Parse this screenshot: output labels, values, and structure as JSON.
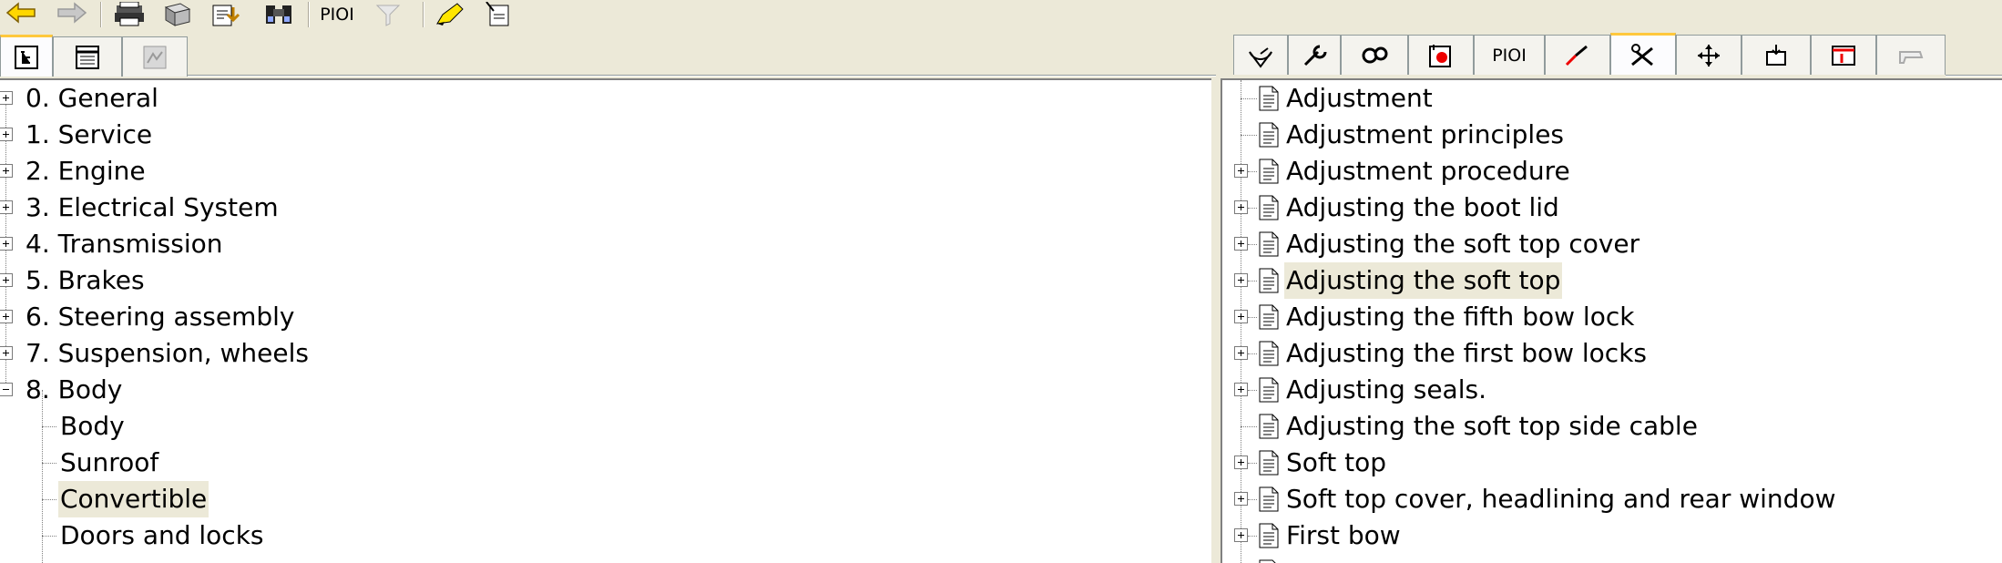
{
  "toolbar": {
    "pioi_label": "PIOI"
  },
  "right_tabs": {
    "pioi_label": "PIOI"
  },
  "left_tree": {
    "items": [
      {
        "label": "0. General",
        "expanded": false
      },
      {
        "label": "1. Service",
        "expanded": false
      },
      {
        "label": "2. Engine",
        "expanded": false
      },
      {
        "label": "3. Electrical System",
        "expanded": false
      },
      {
        "label": "4. Transmission",
        "expanded": false
      },
      {
        "label": "5. Brakes",
        "expanded": false
      },
      {
        "label": "6. Steering assembly",
        "expanded": false
      },
      {
        "label": "7. Suspension, wheels",
        "expanded": false
      },
      {
        "label": "8. Body",
        "expanded": true
      }
    ],
    "children": [
      {
        "label": "Body",
        "selected": false
      },
      {
        "label": "Sunroof",
        "selected": false
      },
      {
        "label": "Convertible",
        "selected": true
      },
      {
        "label": "Doors and locks",
        "selected": false
      }
    ]
  },
  "right_tree": {
    "items": [
      {
        "label": "Adjustment",
        "expandable": false,
        "selected": false
      },
      {
        "label": "Adjustment principles",
        "expandable": false,
        "selected": false
      },
      {
        "label": "Adjustment procedure",
        "expandable": true,
        "selected": false
      },
      {
        "label": "Adjusting the boot lid",
        "expandable": true,
        "selected": false
      },
      {
        "label": "Adjusting the soft top cover",
        "expandable": true,
        "selected": false
      },
      {
        "label": "Adjusting the soft top",
        "expandable": true,
        "selected": true
      },
      {
        "label": "Adjusting the fifth bow lock",
        "expandable": true,
        "selected": false
      },
      {
        "label": "Adjusting the first bow locks",
        "expandable": true,
        "selected": false
      },
      {
        "label": "Adjusting seals.",
        "expandable": true,
        "selected": false
      },
      {
        "label": "Adjusting the soft top side cable",
        "expandable": false,
        "selected": false
      },
      {
        "label": "Soft top",
        "expandable": true,
        "selected": false
      },
      {
        "label": "Soft top cover, headlining and rear window",
        "expandable": true,
        "selected": false
      },
      {
        "label": "First bow",
        "expandable": true,
        "selected": false
      }
    ]
  }
}
